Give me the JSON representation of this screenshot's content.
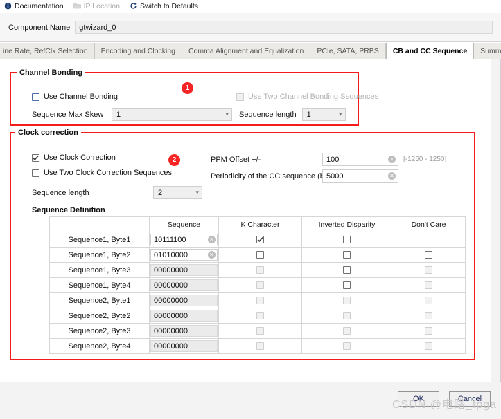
{
  "toolbar": {
    "items": [
      {
        "label": "Documentation",
        "icon": "info-icon",
        "disabled": false
      },
      {
        "label": "IP Location",
        "icon": "folder-icon",
        "disabled": true
      },
      {
        "label": "Switch to Defaults",
        "icon": "refresh-icon",
        "disabled": false
      }
    ]
  },
  "component": {
    "label": "Component Name",
    "value": "gtwizard_0"
  },
  "tabs": {
    "items": [
      {
        "label": "ine Rate, RefClk Selection",
        "active": false
      },
      {
        "label": "Encoding and Clocking",
        "active": false
      },
      {
        "label": "Comma Alignment and Equalization",
        "active": false
      },
      {
        "label": "PCIe, SATA, PRBS",
        "active": false
      },
      {
        "label": "CB and CC Sequence",
        "active": true
      },
      {
        "label": "Summary",
        "active": false
      }
    ],
    "nav": {
      "prev": "◄",
      "next": "►",
      "menu": "≡"
    }
  },
  "channel_bonding": {
    "title": "Channel Bonding",
    "badge": "1",
    "use_channel_bonding": {
      "label": "Use Channel Bonding",
      "checked": false,
      "disabled": false
    },
    "use_two_cb_sequences": {
      "label": "Use Two Channel Bonding Sequences",
      "checked": false,
      "disabled": true
    },
    "sequence_max_skew": {
      "label": "Sequence Max Skew",
      "value": "1"
    },
    "sequence_length": {
      "label": "Sequence length",
      "value": "1"
    }
  },
  "clock_correction": {
    "title": "Clock correction",
    "badge": "2",
    "use_clock_correction": {
      "label": "Use Clock Correction",
      "checked": true,
      "disabled": false
    },
    "use_two_cc_sequences": {
      "label": "Use Two Clock Correction Sequences",
      "checked": false,
      "disabled": false
    },
    "sequence_length": {
      "label": "Sequence length",
      "value": "2"
    },
    "ppm_offset": {
      "label": "PPM Offset +/-",
      "value": "100",
      "hint": "[-1250 - 1250]"
    },
    "periodicity": {
      "label": "Periodicity of the CC sequence (bytes)",
      "value": "5000"
    },
    "sequence_definition": {
      "title": "Sequence Definition",
      "columns": [
        "",
        "Sequence",
        "K Character",
        "Inverted Disparity",
        "Don't Care"
      ],
      "rows": [
        {
          "name": "Sequence1, Byte1",
          "sequence": "10111100",
          "seq_enabled": true,
          "k_character": {
            "checked": true,
            "enabled": true
          },
          "inverted_disparity": {
            "checked": false,
            "enabled": true
          },
          "dont_care": {
            "checked": false,
            "enabled": true
          }
        },
        {
          "name": "Sequence1, Byte2",
          "sequence": "01010000",
          "seq_enabled": true,
          "k_character": {
            "checked": false,
            "enabled": true
          },
          "inverted_disparity": {
            "checked": false,
            "enabled": true
          },
          "dont_care": {
            "checked": false,
            "enabled": true
          }
        },
        {
          "name": "Sequence1, Byte3",
          "sequence": "00000000",
          "seq_enabled": false,
          "k_character": {
            "checked": false,
            "enabled": false
          },
          "inverted_disparity": {
            "checked": false,
            "enabled": true
          },
          "dont_care": {
            "checked": false,
            "enabled": false
          }
        },
        {
          "name": "Sequence1, Byte4",
          "sequence": "00000000",
          "seq_enabled": false,
          "k_character": {
            "checked": false,
            "enabled": false
          },
          "inverted_disparity": {
            "checked": false,
            "enabled": true
          },
          "dont_care": {
            "checked": false,
            "enabled": false
          }
        },
        {
          "name": "Sequence2, Byte1",
          "sequence": "00000000",
          "seq_enabled": false,
          "k_character": {
            "checked": false,
            "enabled": false
          },
          "inverted_disparity": {
            "checked": false,
            "enabled": false
          },
          "dont_care": {
            "checked": false,
            "enabled": false
          }
        },
        {
          "name": "Sequence2, Byte2",
          "sequence": "00000000",
          "seq_enabled": false,
          "k_character": {
            "checked": false,
            "enabled": false
          },
          "inverted_disparity": {
            "checked": false,
            "enabled": false
          },
          "dont_care": {
            "checked": false,
            "enabled": false
          }
        },
        {
          "name": "Sequence2, Byte3",
          "sequence": "00000000",
          "seq_enabled": false,
          "k_character": {
            "checked": false,
            "enabled": false
          },
          "inverted_disparity": {
            "checked": false,
            "enabled": false
          },
          "dont_care": {
            "checked": false,
            "enabled": false
          }
        },
        {
          "name": "Sequence2, Byte4",
          "sequence": "00000000",
          "seq_enabled": false,
          "k_character": {
            "checked": false,
            "enabled": false
          },
          "inverted_disparity": {
            "checked": false,
            "enabled": false
          },
          "dont_care": {
            "checked": false,
            "enabled": false
          }
        }
      ]
    }
  },
  "footer": {
    "ok_label": "OK",
    "cancel_label": "Cancel"
  },
  "watermark": "CSDN @电路_fpga",
  "colors": {
    "annotation_red": "#f51b1b",
    "badge_red": "#f52525",
    "accent_blue": "#4a6fa5",
    "tab_bg": "#eceae7"
  }
}
